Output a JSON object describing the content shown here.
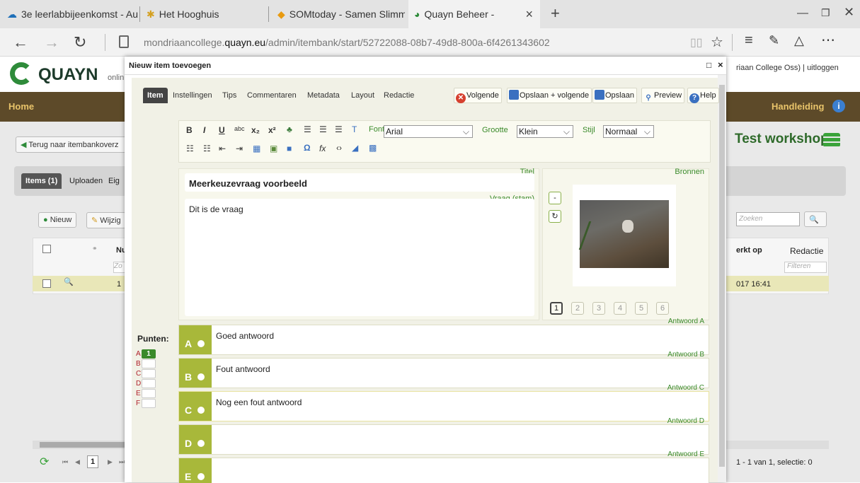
{
  "browser": {
    "tabs": [
      {
        "label": "3e leerlabbijeenkomst - Au",
        "icon": "cloud-icon"
      },
      {
        "label": "Het Hooghuis",
        "icon": "star-burst-icon"
      },
      {
        "label": "SOMtoday - Samen Slimme",
        "icon": "diamond-icon"
      },
      {
        "label": "Quayn Beheer -",
        "icon": "quayn-icon"
      }
    ],
    "close_tab": "×",
    "new_tab": "+",
    "url_prefix": "mondriaancollege.",
    "url_domain": "quayn.eu",
    "url_path": "/admin/itembank/start/52722088-08b7-49d8-800a-6f4261343602"
  },
  "page": {
    "logo_text": "QUAYN",
    "logo_sub": "onlin",
    "user_text": "riaan College Oss)  |  uitloggen",
    "nav_home": "Home",
    "nav_manual": "Handleiding",
    "back_button": "Terug naar itembankoverz",
    "workshop_title": "Test workshop",
    "tabs": [
      "Items (1)",
      "Uploaden",
      "Eig"
    ],
    "toolbar": {
      "new": "Nieuw",
      "edit": "Wijzig"
    },
    "search_placeholder": "Zoeken",
    "grid": {
      "col_nu": "Nu",
      "col_changed": "erkt op",
      "col_redaction": "Redactie",
      "filter_zo": "Zo",
      "filter_placeholder": "Filteren",
      "row_num": "1",
      "row_date": "017 16:41"
    },
    "pager_current": "1",
    "pager_status": "1 - 1 van 1,  selectie: 0"
  },
  "modal": {
    "title": "Nieuw item toevoegen",
    "tabs": [
      "Item",
      "Instellingen",
      "Tips",
      "Commentaren",
      "Metadata",
      "Layout",
      "Redactie"
    ],
    "actions": {
      "next": "Volgende",
      "save_next": "Opslaan + volgende",
      "save": "Opslaan",
      "preview": "Preview",
      "help": "Help"
    },
    "editor": {
      "font_label": "Font",
      "font_value": "Arial",
      "size_label": "Grootte",
      "size_value": "Klein",
      "style_label": "Stijl",
      "style_value": "Normaal"
    },
    "labels": {
      "title": "Titel",
      "stem": "Vraag (stam)",
      "sources": "Bronnen"
    },
    "item_title": "Meerkeuzevraag voorbeeld",
    "item_stem": "Dit is de vraag",
    "source_pages": [
      "1",
      "2",
      "3",
      "4",
      "5",
      "6"
    ],
    "source_minus": "-",
    "points_label": "Punten:",
    "points": [
      {
        "letter": "A",
        "value": "1"
      },
      {
        "letter": "B",
        "value": ""
      },
      {
        "letter": "C",
        "value": ""
      },
      {
        "letter": "D",
        "value": ""
      },
      {
        "letter": "E",
        "value": ""
      },
      {
        "letter": "F",
        "value": ""
      }
    ],
    "answers": [
      {
        "letter": "A",
        "label": "Antwoord A",
        "text": "Goed antwoord"
      },
      {
        "letter": "B",
        "label": "Antwoord B",
        "text": "Fout antwoord"
      },
      {
        "letter": "C",
        "label": "Antwoord C",
        "text": "Nog een fout antwoord"
      },
      {
        "letter": "D",
        "label": "Antwoord D",
        "text": ""
      },
      {
        "letter": "E",
        "label": "Antwoord E",
        "text": ""
      }
    ]
  },
  "colors": {
    "nav_bg": "#5d4a29",
    "accent_green": "#a8b83a",
    "label_green": "#3a8a2a",
    "points_red": "#b0202b"
  }
}
